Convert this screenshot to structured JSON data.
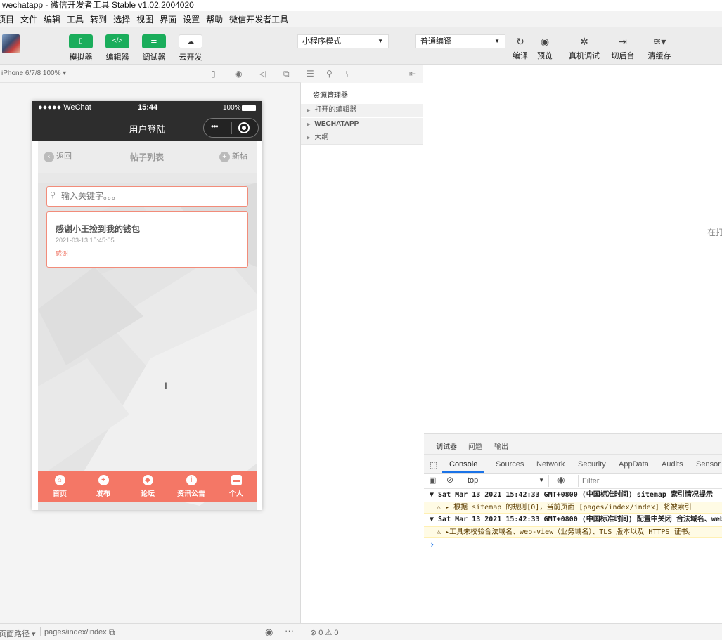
{
  "window": {
    "title": "wechatapp - 微信开发者工具 Stable v1.02.2004020"
  },
  "menu": {
    "items": [
      "项目",
      "文件",
      "编辑",
      "工具",
      "转到",
      "选择",
      "视图",
      "界面",
      "设置",
      "帮助",
      "微信开发者工具"
    ]
  },
  "toolbar": {
    "simulator": "模拟器",
    "editor": "编辑器",
    "debugger": "调试器",
    "cloud": "云开发",
    "mode_select": "小程序模式",
    "compile_select": "普通编译",
    "compile": "编译",
    "preview": "预览",
    "remote_debug": "真机调试",
    "backend": "切后台",
    "clear_cache": "清缓存"
  },
  "simulator": {
    "device": "iPhone 6/7/8 100% ▾"
  },
  "phone": {
    "carrier": "●●●●● WeChat",
    "time": "15:44",
    "battery": "100%",
    "nav_title": "用户登陆",
    "header": {
      "back": "返回",
      "title": "帖子列表",
      "new": "新帖"
    },
    "search_placeholder": "输入关键字。。。",
    "post": {
      "title": "感谢小王捡到我的钱包",
      "date": "2021-03-13 15:45:05",
      "tag": "感谢"
    },
    "tabs": [
      {
        "label": "首页"
      },
      {
        "label": "发布"
      },
      {
        "label": "论坛"
      },
      {
        "label": "资讯公告"
      },
      {
        "label": "个人"
      }
    ]
  },
  "explorer": {
    "title": "资源管理器",
    "sections": [
      "打开的编辑器",
      "WECHATAPP",
      "大纲"
    ]
  },
  "editor": {
    "hint": "在打"
  },
  "devtools": {
    "top_tabs": [
      "调试器",
      "问题",
      "输出"
    ],
    "tabs": [
      "Console",
      "Sources",
      "Network",
      "Security",
      "AppData",
      "Audits",
      "Sensor"
    ],
    "context": "top",
    "filter_placeholder": "Filter",
    "logs": [
      "▼ Sat Mar 13 2021 15:42:33 GMT+0800 (中国标准时间) sitemap 索引情况提示",
      "⚠ ▸ 根据 sitemap 的规则[0]，当前页面 [pages/index/index] 将被索引",
      "▼ Sat Mar 13 2021 15:42:33 GMT+0800 (中国标准时间) 配置中关闭 合法域名、web",
      "⚠ ▸工具未校验合法域名、web-view（业务域名）、TLS 版本以及 HTTPS 证书。"
    ],
    "prompt": "›"
  },
  "statusbar": {
    "path_label": "页面路径 ▾",
    "path": "pages/index/index",
    "errors": "⊗ 0 ⚠ 0"
  }
}
